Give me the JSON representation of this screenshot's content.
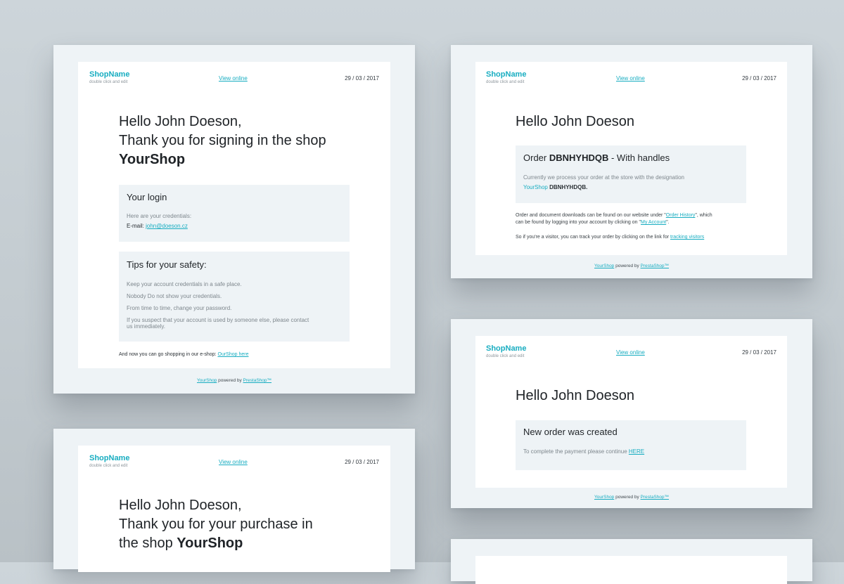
{
  "colors": {
    "accent": "#18adc1",
    "background": "#c8d0d5",
    "card": "#eef3f6",
    "panel": "#ffffff"
  },
  "brand": {
    "name": "ShopName",
    "tagline": "double click and edit"
  },
  "header": {
    "view_online": "View online",
    "date": "29 / 03 / 2017"
  },
  "footer": {
    "shop_link": "YourShop",
    "powered_text": "powered by",
    "prestashop_link": "PrestaShop™"
  },
  "email_signin": {
    "headline_line1": "Hello John Doeson,",
    "headline_line2": "Thank you for signing in the shop",
    "headline_shop": "YourShop",
    "login_box": {
      "title": "Your login",
      "credentials_text": "Here are your credentials:",
      "email_label": "E-mail:",
      "email_value": "john@doeson.cz"
    },
    "tips_box": {
      "title": "Tips for your safety:",
      "tips": [
        "Keep your account credentials in a safe place.",
        "Nobody Do not show your credentials.",
        "From time to time, change your password.",
        "If you suspect that your account is used by someone else, please contact",
        "us immediately."
      ]
    },
    "shopping_text": "And now you can go shopping in our e-shop:",
    "shopping_link": "OurShop here"
  },
  "email_order": {
    "headline": "Hello John Doeson",
    "order_box": {
      "title_prefix": "Order",
      "order_id": "DBNHYHDQB",
      "title_suffix": "- With handles",
      "desc": "Currently we process your order at the store with the designation",
      "store_name": "YourShop",
      "store_id": "DBNHYHDQB."
    },
    "para1_a": "Order and document downloads can be found on our website under \"",
    "para1_link": "Order History",
    "para1_b": "\", which",
    "para1_c": "can be found by logging into your account by clicking on \"",
    "para1_link2": "My Account",
    "para1_d": "\".",
    "para2": "So if you're a visitor, you can track your order by clicking on the link for",
    "para2_link": "tracking visitors"
  },
  "email_new_order": {
    "headline": "Hello John Doeson",
    "box_title": "New order was created",
    "box_text": "To complete the payment please continue",
    "box_link": "HERE"
  },
  "email_purchase": {
    "headline_line1": "Hello John Doeson,",
    "headline_line2": "Thank you for your purchase in",
    "headline_line3_prefix": "the shop",
    "headline_shop": "YourShop"
  }
}
